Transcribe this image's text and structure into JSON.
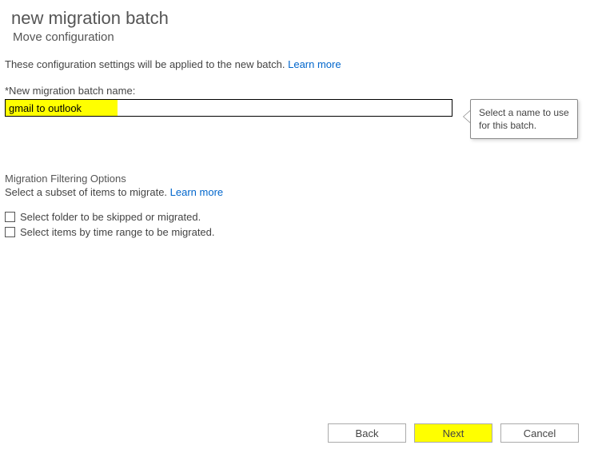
{
  "header": {
    "title": "new migration batch",
    "subtitle": "Move configuration"
  },
  "intro": {
    "text": "These configuration settings will be applied to the new batch. ",
    "learn_more": "Learn more"
  },
  "batch_name": {
    "label": "*New migration batch name:",
    "value": "gmail to outlook"
  },
  "tooltip": {
    "text": "Select a name to use for this batch."
  },
  "filtering": {
    "heading": "Migration Filtering Options",
    "desc_text": "Select a subset of items to migrate. ",
    "learn_more": "Learn more",
    "options": [
      "Select folder to be skipped or migrated.",
      "Select items by time range to be migrated."
    ]
  },
  "buttons": {
    "back": "Back",
    "next": "Next",
    "cancel": "Cancel"
  }
}
